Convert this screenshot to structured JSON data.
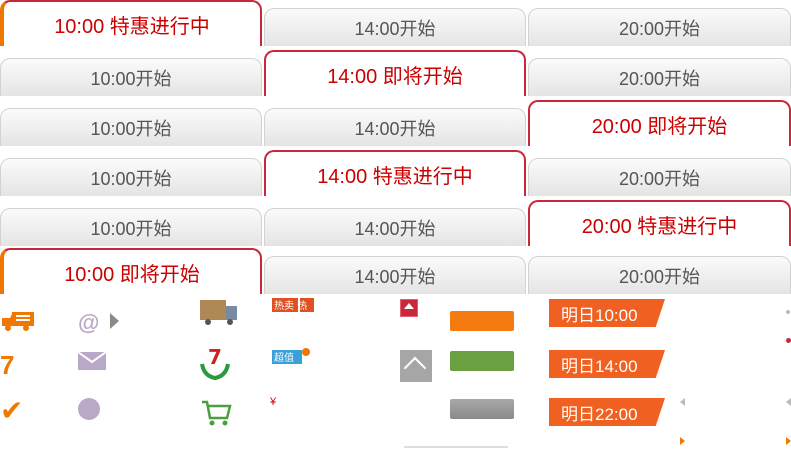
{
  "rows": [
    {
      "tabs": [
        {
          "label": "10:00 特惠进行中"
        },
        {
          "label": "14:00开始"
        },
        {
          "label": "20:00开始"
        }
      ]
    },
    {
      "tabs": [
        {
          "label": "10:00开始"
        },
        {
          "label": "14:00 即将开始"
        },
        {
          "label": "20:00开始"
        }
      ]
    },
    {
      "tabs": [
        {
          "label": "10:00开始"
        },
        {
          "label": "14:00开始"
        },
        {
          "label": "20:00 即将开始"
        }
      ]
    },
    {
      "tabs": [
        {
          "label": "10:00开始"
        },
        {
          "label": "14:00 特惠进行中"
        },
        {
          "label": "20:00开始"
        }
      ]
    },
    {
      "tabs": [
        {
          "label": "10:00开始"
        },
        {
          "label": "14:00开始"
        },
        {
          "label": "20:00 特惠进行中"
        }
      ]
    },
    {
      "tabs": [
        {
          "label": "10:00 即将开始"
        },
        {
          "label": "14:00开始"
        },
        {
          "label": "20:00开始"
        }
      ]
    }
  ],
  "sprites": {
    "at_symbol": "@",
    "seven_orange": "7",
    "check_mark": "✔",
    "hot_badge": "热卖 热",
    "chao_badge": "超值",
    "yen": "¥"
  },
  "tags": {
    "tomorrow_10": "明日10:00",
    "tomorrow_14": "明日14:00",
    "tomorrow_22": "明日22:00"
  },
  "colors": {
    "active_red": "#cc0000",
    "border_red": "#c8283a",
    "orange": "#f57a10",
    "green": "#6aa040",
    "tag_orange": "#f06020"
  }
}
